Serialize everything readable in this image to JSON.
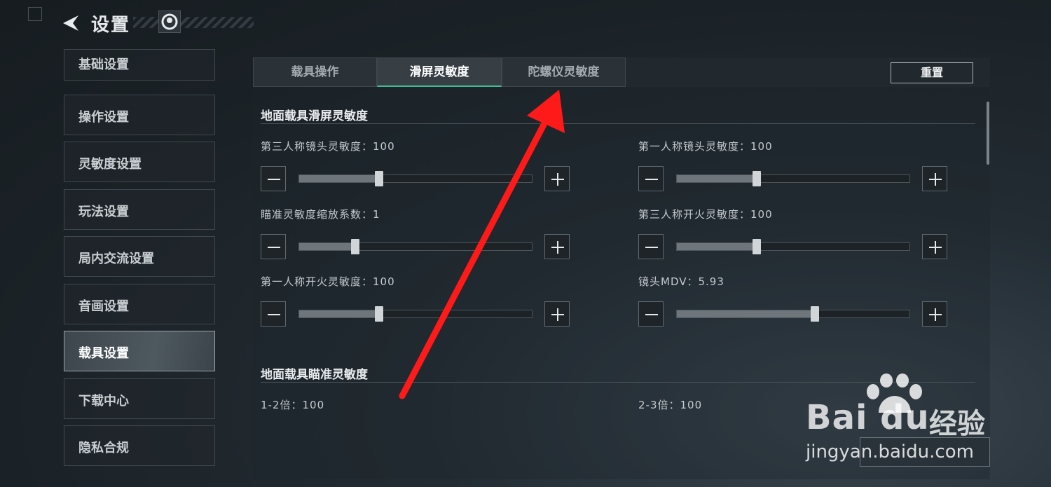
{
  "header": {
    "title": "设置"
  },
  "sidebar": {
    "items": [
      {
        "label": "基础设置"
      },
      {
        "label": "操作设置"
      },
      {
        "label": "灵敏度设置"
      },
      {
        "label": "玩法设置"
      },
      {
        "label": "局内交流设置"
      },
      {
        "label": "音画设置"
      },
      {
        "label": "载具设置",
        "active": true
      },
      {
        "label": "下载中心"
      },
      {
        "label": "隐私合规"
      }
    ]
  },
  "tabs": [
    {
      "label": "载具操作"
    },
    {
      "label": "滑屏灵敏度",
      "active": true
    },
    {
      "label": "陀螺仪灵敏度"
    }
  ],
  "reset_label": "重置",
  "sections": [
    {
      "title": "地面载具滑屏灵敏度",
      "sliders": [
        {
          "label": "第三人称镜头灵敏度：100",
          "fraction": 0.34
        },
        {
          "label": "第一人称镜头灵敏度：100",
          "fraction": 0.34
        },
        {
          "label": "瞄准灵敏度缩放系数：1",
          "fraction": 0.24
        },
        {
          "label": "第三人称开火灵敏度：100",
          "fraction": 0.34
        },
        {
          "label": "第一人称开火灵敏度：100",
          "fraction": 0.34
        },
        {
          "label": "镜头MDV：5.93",
          "fraction": 0.59
        }
      ]
    },
    {
      "title": "地面载具瞄准灵敏度",
      "values": [
        {
          "label": "1-2倍：100"
        },
        {
          "label": "2-3倍：100"
        }
      ]
    }
  ],
  "watermark": {
    "brand": "Bai du",
    "name": "经验",
    "url": "jingyan.baidu.com"
  },
  "colors": {
    "accent": "#3fbf95",
    "annotation_arrow": "#ff1a1a"
  }
}
